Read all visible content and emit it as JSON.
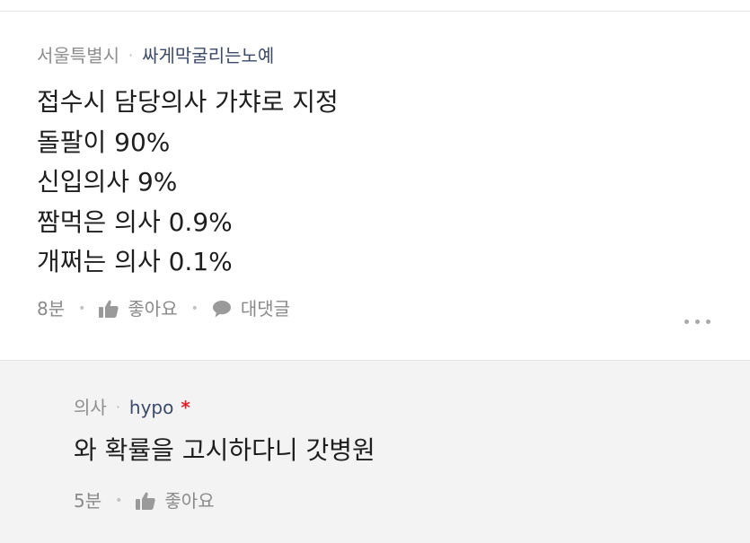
{
  "main_comment": {
    "region": "서울특별시",
    "nickname": "싸게막굴리는노예",
    "lines": [
      "접수시 담당의사 가챠로 지정",
      "돌팔이 90%",
      "신입의사 9%",
      "짬먹은 의사 0.9%",
      "개쩌는 의사 0.1%"
    ],
    "time": "8분",
    "like_label": "좋아요",
    "reply_label": "대댓글"
  },
  "reply": {
    "region": "의사",
    "nickname": "hypo",
    "author_mark": "*",
    "text": "와 확률을 고시하다니 갓병원",
    "time": "5분",
    "like_label": "좋아요"
  },
  "icons": {
    "like": "thumbs-up-icon",
    "reply": "speech-bubble-icon",
    "more": "more-dots-icon"
  },
  "colors": {
    "nickname": "#3b4a6b",
    "author_mark": "#e0202a",
    "muted": "#8a8a8a",
    "reply_bg": "#f3f3f3"
  }
}
